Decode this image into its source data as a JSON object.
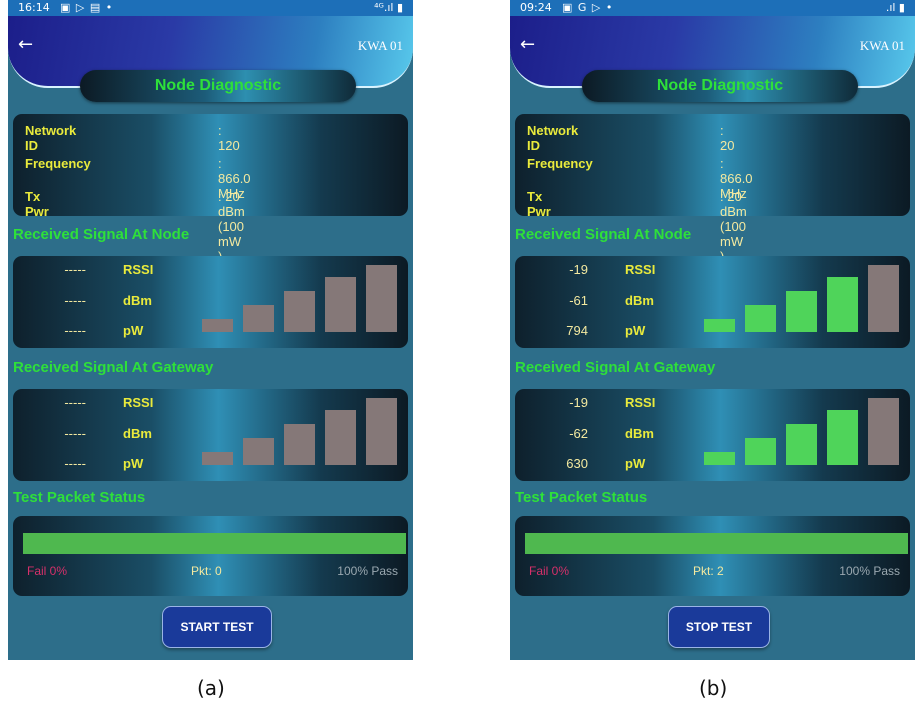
{
  "panels": [
    {
      "id": "a",
      "status_bar": {
        "time": "16:14",
        "icons": "▣ ▷ ▤ •",
        "signal": "⁴ᴳ.ıl ▮"
      },
      "back_icon": "←",
      "device_name": "KWA 01",
      "title": "Node Diagnostic",
      "info": [
        {
          "label": "Network ID",
          "value": ": 120"
        },
        {
          "label": "Frequency",
          "value": ": 866.0 MHz"
        },
        {
          "label": "Tx Pwr",
          "value": ": 20 dBm (100 mW )"
        }
      ],
      "node_section_title": "Received Signal At Node",
      "node_signal": {
        "rows": [
          {
            "value": "-----",
            "label": "RSSI"
          },
          {
            "value": "-----",
            "label": "dBm"
          },
          {
            "value": "-----",
            "label": "pW"
          }
        ],
        "bars_lit": 0
      },
      "gateway_section_title": "Received Signal At Gateway",
      "gateway_signal": {
        "rows": [
          {
            "value": "-----",
            "label": "RSSI"
          },
          {
            "value": "-----",
            "label": "dBm"
          },
          {
            "value": "-----",
            "label": "pW"
          }
        ],
        "bars_lit": 0
      },
      "packet_section_title": "Test Packet Status",
      "packet": {
        "progress_fraction": 1.0,
        "fail_text": "Fail  0%",
        "pkt_text": "Pkt:   0",
        "pass_text": "100%  Pass"
      },
      "button_label": "START TEST",
      "caption": "(a)"
    },
    {
      "id": "b",
      "status_bar": {
        "time": "09:24",
        "icons": "▣ G ▷ •",
        "signal": ".ıl ▮"
      },
      "back_icon": "←",
      "device_name": "KWA 01",
      "title": "Node Diagnostic",
      "info": [
        {
          "label": "Network ID",
          "value": ": 20"
        },
        {
          "label": "Frequency",
          "value": ": 866.0 MHz"
        },
        {
          "label": "Tx Pwr",
          "value": ": 20 dBm (100 mW )"
        }
      ],
      "node_section_title": "Received Signal At Node",
      "node_signal": {
        "rows": [
          {
            "value": "-19",
            "label": "RSSI"
          },
          {
            "value": "-61",
            "label": "dBm"
          },
          {
            "value": "794",
            "label": "pW"
          }
        ],
        "bars_lit": 4
      },
      "gateway_section_title": "Received Signal At Gateway",
      "gateway_signal": {
        "rows": [
          {
            "value": "-19",
            "label": "RSSI"
          },
          {
            "value": "-62",
            "label": "dBm"
          },
          {
            "value": "630",
            "label": "pW"
          }
        ],
        "bars_lit": 4
      },
      "packet_section_title": "Test Packet Status",
      "packet": {
        "progress_fraction": 1.0,
        "fail_text": "Fail  0%",
        "pkt_text": "Pkt:   2",
        "pass_text": "100%  Pass"
      },
      "button_label": "STOP TEST",
      "caption": "(b)"
    }
  ],
  "colors": {
    "screen_bg": "#2d6e8a",
    "header_gradient_start": "#1c1e8a",
    "header_gradient_end": "#58c9ec",
    "title_green": "#2ee03a",
    "label_yellow": "#e9ea3c",
    "value_cream": "#f3e9a0",
    "bar_off": "#857878",
    "bar_on": "#4fd45a",
    "progress_green": "#4fb84f",
    "fail_red": "#d6306a",
    "button_blue": "#1a3a9a"
  }
}
